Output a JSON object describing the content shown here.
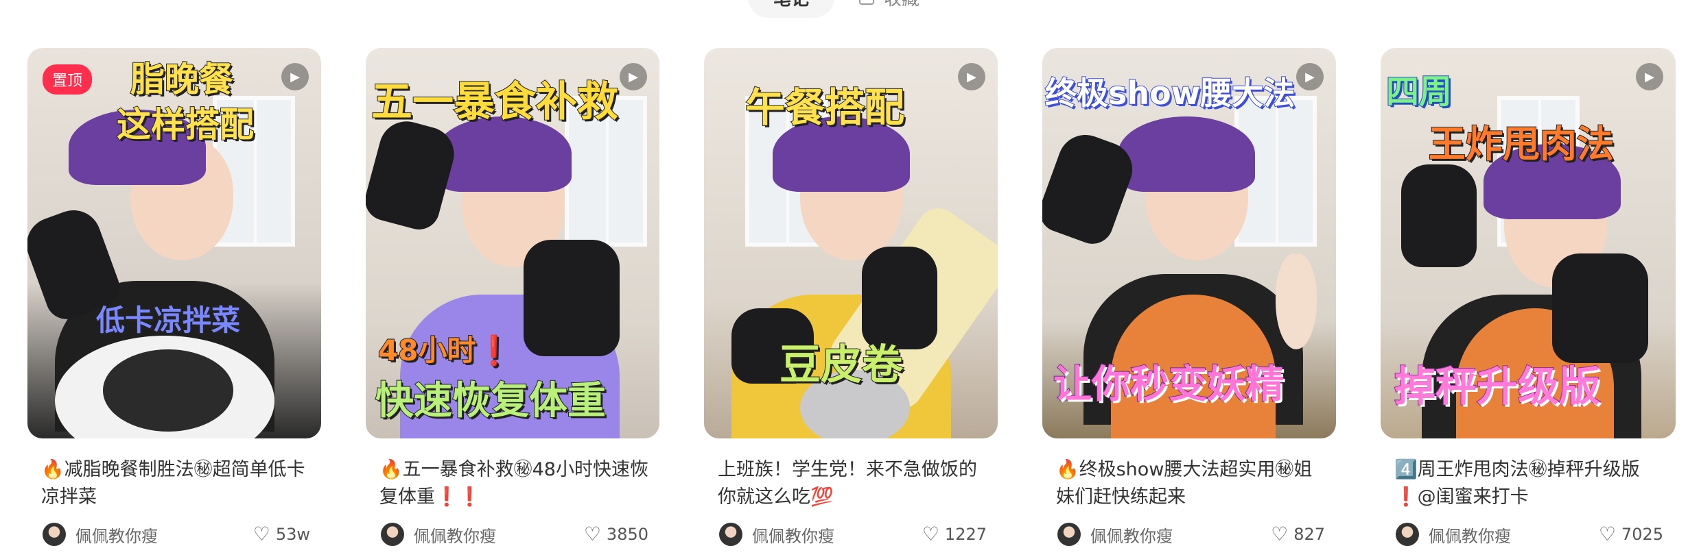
{
  "tabs": [
    {
      "label": "笔记"
    },
    {
      "label": "收藏"
    }
  ],
  "icons": {
    "play": "play-icon",
    "like": "heart-outline-icon",
    "collect": "collect-icon"
  },
  "colors": {
    "pin_bg": "#ff2e4d",
    "text": "#333333",
    "muted": "#666666"
  },
  "cards": [
    {
      "pinned_label": "置顶",
      "cover_text": [
        "脂晚餐",
        "这样搭配",
        "低卡凉拌菜"
      ],
      "title": "🔥减脂晚餐制胜法㊙超简单低卡凉拌菜",
      "author": "佩佩教你瘦",
      "likes": "53w"
    },
    {
      "cover_text": [
        "五一暴食补救",
        "48小时❗",
        "快速恢复体重"
      ],
      "title": "🔥五一暴食补救㊙48小时快速恢复体重❗❗",
      "author": "佩佩教你瘦",
      "likes": "3850"
    },
    {
      "cover_text": [
        "午餐搭配",
        "豆皮卷"
      ],
      "title": "上班族！学生党！来不急做饭的你就这么吃💯",
      "author": "佩佩教你瘦",
      "likes": "1227"
    },
    {
      "cover_text": [
        "终极show腰大法",
        "让你秒变妖精"
      ],
      "title": "🔥终极show腰大法超实用㊙姐妹们赶快练起来",
      "author": "佩佩教你瘦",
      "likes": "827"
    },
    {
      "cover_text": [
        "四周",
        "王炸甩肉法",
        "掉秤升级版"
      ],
      "title": "4️⃣周王炸甩肉法㊙掉秤升级版❗@闺蜜来打卡",
      "author": "佩佩教你瘦",
      "likes": "7025"
    }
  ]
}
